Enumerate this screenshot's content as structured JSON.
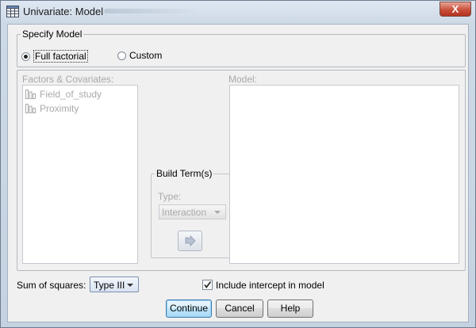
{
  "window": {
    "title": "Univariate: Model",
    "close_label": "X"
  },
  "specify_model": {
    "legend": "Specify Model",
    "options": [
      {
        "label": "Full factorial",
        "selected": true
      },
      {
        "label": "Custom",
        "selected": false
      }
    ]
  },
  "factors": {
    "label": "Factors & Covariates:",
    "items": [
      "Field_of_study",
      "Proximity"
    ]
  },
  "model": {
    "label": "Model:"
  },
  "build_terms": {
    "legend": "Build Term(s)",
    "type_label": "Type:",
    "type_value": "Interaction",
    "arrow_icon": "right-arrow-icon"
  },
  "sum_of_squares": {
    "label": "Sum of squares:",
    "value": "Type III"
  },
  "intercept": {
    "label": "Include intercept in model",
    "checked": true
  },
  "buttons": {
    "continue": "Continue",
    "cancel": "Cancel",
    "help": "Help"
  }
}
